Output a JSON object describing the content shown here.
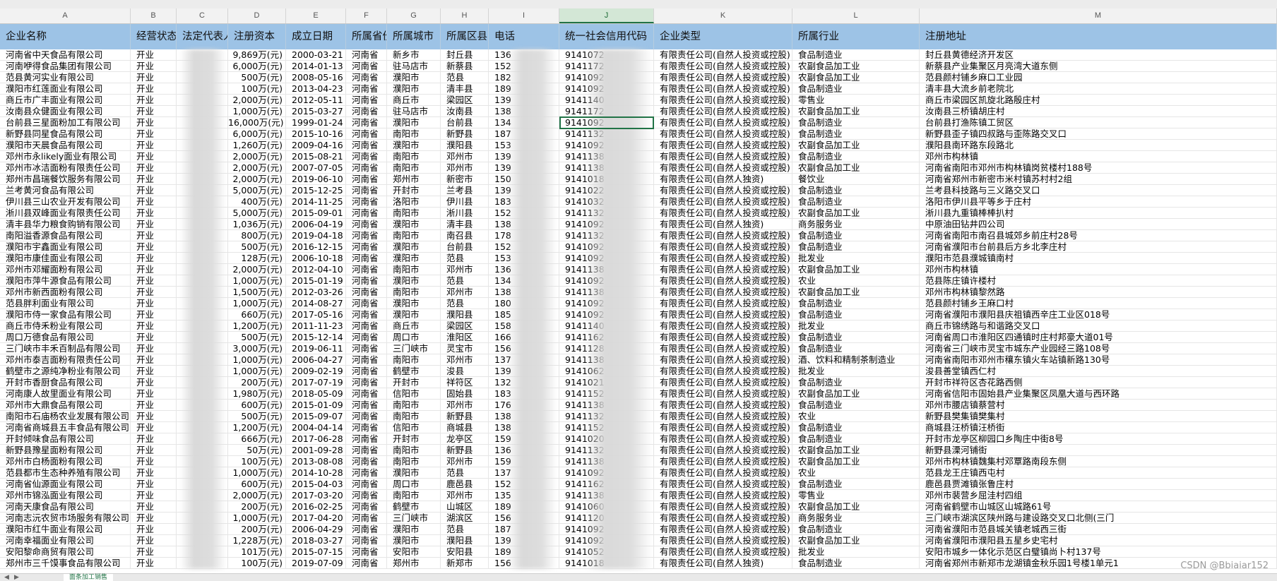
{
  "column_letters": [
    "A",
    "B",
    "C",
    "D",
    "E",
    "F",
    "G",
    "H",
    "I",
    "J",
    "K",
    "L",
    "M"
  ],
  "selected_column": "J",
  "headers": [
    "企业名称",
    "经营状态",
    "法定代表人",
    "注册资本",
    "成立日期",
    "所属省份",
    "所属城市",
    "所属区县",
    "电话",
    "统一社会信用代码",
    "企业类型",
    "所属行业",
    "注册地址"
  ],
  "rows": [
    [
      "河南省中天食品有限公司",
      "开业",
      "",
      "9,869万(元)",
      "2000-03-21",
      "河南省",
      "新乡市",
      "封丘县",
      "136",
      "9141072",
      "有限责任公司(自然人投资或控股)",
      "食品制造业",
      "封丘县黄德经济开发区"
    ],
    [
      "河南咿得食品集团有限公司",
      "开业",
      "",
      "6,000万(元)",
      "2014-01-13",
      "河南省",
      "驻马店市",
      "新蔡县",
      "152",
      "9141172",
      "有限责任公司(自然人投资或控股)",
      "农副食品加工业",
      "新蔡县产业集聚区月亮湾大道东侧"
    ],
    [
      "范县黄河实业有限公司",
      "开业",
      "",
      "500万(元)",
      "2008-05-16",
      "河南省",
      "濮阳市",
      "范县",
      "182",
      "9141092",
      "有限责任公司(自然人投资或控股)",
      "农副食品加工业",
      "范县颜村铺乡麻口工业园"
    ],
    [
      "濮阳市红莲面业有限公司",
      "开业",
      "",
      "100万(元)",
      "2013-04-23",
      "河南省",
      "濮阳市",
      "清丰县",
      "189",
      "9141092",
      "有限责任公司(自然人投资或控股)",
      "食品制造业",
      "清丰县大流乡前老院北"
    ],
    [
      "商丘市广丰面业有限公司",
      "开业",
      "",
      "2,000万(元)",
      "2012-05-11",
      "河南省",
      "商丘市",
      "梁园区",
      "139",
      "9141140",
      "有限责任公司(自然人投资或控股)",
      "零售业",
      "商丘市梁园区凯旋北路殷庄村"
    ],
    [
      "汝南县众健面业有限公司",
      "开业",
      "",
      "1,000万(元)",
      "2015-03-27",
      "河南省",
      "驻马店市",
      "汝南县",
      "138",
      "9141172",
      "有限责任公司(自然人投资或控股)",
      "农副食品加工业",
      "汝南县三桥镇胡庄村"
    ],
    [
      "台前县三星面粉加工有限公司",
      "开业",
      "",
      "16,000万(元)",
      "1999-01-24",
      "河南省",
      "濮阳市",
      "台前县",
      "134",
      "9141092",
      "有限责任公司(自然人投资或控股)",
      "食品制造业",
      "台前县打渔陈镇工贸区"
    ],
    [
      "新野县同星食品有限公司",
      "开业",
      "",
      "6,000万(元)",
      "2015-10-16",
      "河南省",
      "南阳市",
      "新野县",
      "187",
      "9141132",
      "有限责任公司(自然人投资或控股)",
      "食品制造业",
      "新野县歪子镇四叔路与歪陈路交叉口"
    ],
    [
      "濮阳市天晨食品有限公司",
      "开业",
      "",
      "1,260万(元)",
      "2009-04-16",
      "河南省",
      "濮阳市",
      "濮阳县",
      "153",
      "9141092",
      "有限责任公司(自然人投资或控股)",
      "农副食品加工业",
      "濮阳县南环路东段路北"
    ],
    [
      "邓州市永likely面业有限公司",
      "开业",
      "",
      "2,000万(元)",
      "2015-08-21",
      "河南省",
      "南阳市",
      "邓州市",
      "139",
      "9141138",
      "有限责任公司(自然人投资或控股)",
      "食品制造业",
      "邓州市构林镇"
    ],
    [
      "邓州市冰洁面粉有限责任公司",
      "开业",
      "",
      "2,000万(元)",
      "2007-07-05",
      "河南省",
      "南阳市",
      "邓州市",
      "139",
      "9141138",
      "有限责任公司(自然人投资或控股)",
      "农副食品加工业",
      "河南省南阳市邓州市构林镇岗贫楼村188号"
    ],
    [
      "郑州市昌瑞餐饮服务有限公司",
      "开业",
      "",
      "2,000万(元)",
      "2019-06-10",
      "河南省",
      "郑州市",
      "新密市",
      "150",
      "9141018",
      "有限责任公司(自然人独资)",
      "餐饮业",
      "河南省郑州市新密市米村镇苏村村2组"
    ],
    [
      "兰考黄河食品有限公司",
      "开业",
      "",
      "5,000万(元)",
      "2015-12-25",
      "河南省",
      "开封市",
      "兰考县",
      "139",
      "9141022",
      "有限责任公司(自然人投资或控股)",
      "食品制造业",
      "兰考县科技路与三义路交叉口"
    ],
    [
      "伊川县三山农业开发有限公司",
      "开业",
      "",
      "400万(元)",
      "2014-11-25",
      "河南省",
      "洛阳市",
      "伊川县",
      "183",
      "9141032",
      "有限责任公司(自然人投资或控股)",
      "食品制造业",
      "洛阳市伊川县平等乡于庄村"
    ],
    [
      "淅川县双峰面业有限责任公司",
      "开业",
      "",
      "5,000万(元)",
      "2015-09-01",
      "河南省",
      "南阳市",
      "淅川县",
      "152",
      "9141132",
      "有限责任公司(自然人投资或控股)",
      "农副食品加工业",
      "淅川县九重镇棒棒扒村"
    ],
    [
      "清丰县华力粮食购销有限公司",
      "开业",
      "",
      "1,036万(元)",
      "2006-04-19",
      "河南省",
      "濮阳市",
      "清丰县",
      "138",
      "9141092",
      "有限责任公司(自然人独资)",
      "商务服务业",
      "中原油田钻井四公司"
    ],
    [
      "南阳溢香源食品有限公司",
      "开业",
      "",
      "800万(元)",
      "2019-04-18",
      "河南省",
      "南阳市",
      "南召县",
      "178",
      "9141132",
      "有限责任公司(自然人投资或控股)",
      "食品制造业",
      "河南省南阳市南召县城郊乡前庄村28号"
    ],
    [
      "濮阳市宇鑫面业有限公司",
      "开业",
      "",
      "500万(元)",
      "2016-12-15",
      "河南省",
      "濮阳市",
      "台前县",
      "152",
      "9141092",
      "有限责任公司(自然人投资或控股)",
      "食品制造业",
      "河南省濮阳市台前县后方乡北李庄村"
    ],
    [
      "濮阳市康佳面业有限公司",
      "开业",
      "",
      "128万(元)",
      "2006-10-18",
      "河南省",
      "濮阳市",
      "范县",
      "153",
      "9141092",
      "有限责任公司(自然人投资或控股)",
      "批发业",
      "濮阳市范县濮城镇南村"
    ],
    [
      "邓州市邓耀面粉有限公司",
      "开业",
      "",
      "2,000万(元)",
      "2012-04-10",
      "河南省",
      "南阳市",
      "邓州市",
      "136",
      "9141138",
      "有限责任公司(自然人投资或控股)",
      "农副食品加工业",
      "邓州市构林镇"
    ],
    [
      "濮阳市萍牛源食品有限公司",
      "开业",
      "",
      "1,000万(元)",
      "2015-01-19",
      "河南省",
      "濮阳市",
      "范县",
      "134",
      "9141092",
      "有限责任公司(自然人投资或控股)",
      "农业",
      "范县陈庄镇许楼村"
    ],
    [
      "邓州市新西面粉有限公司",
      "开业",
      "",
      "1,500万(元)",
      "2012-03-26",
      "河南省",
      "南阳市",
      "邓州市",
      "138",
      "9141138",
      "有限责任公司(自然人投资或控股)",
      "农副食品加工业",
      "邓州市构林镇黎然路"
    ],
    [
      "范县胖利面业有限公司",
      "开业",
      "",
      "1,000万(元)",
      "2014-08-27",
      "河南省",
      "濮阳市",
      "范县",
      "180",
      "9141092",
      "有限责任公司(自然人投资或控股)",
      "食品制造业",
      "范县颜村铺乡王麻口村"
    ],
    [
      "濮阳市侍一家食品有限公司",
      "开业",
      "",
      "660万(元)",
      "2017-05-16",
      "河南省",
      "濮阳市",
      "濮阳县",
      "185",
      "9141092",
      "有限责任公司(自然人投资或控股)",
      "食品制造业",
      "河南省濮阳市濮阳县庆祖镇西辛庄工业区018号"
    ],
    [
      "商丘市侍禾粉业有限公司",
      "开业",
      "",
      "1,200万(元)",
      "2011-11-23",
      "河南省",
      "商丘市",
      "梁园区",
      "158",
      "9141140",
      "有限责任公司(自然人投资或控股)",
      "批发业",
      "商丘市锦绣路与和谐路交叉口"
    ],
    [
      "周口万德食品有限公司",
      "开业",
      "",
      "500万(元)",
      "2015-12-14",
      "河南省",
      "周口市",
      "淮阳区",
      "166",
      "9141162",
      "有限责任公司(自然人投资或控股)",
      "食品制造业",
      "河南省周口市淮阳区四通镇时庄村邦豪大道01号"
    ],
    [
      "三门峡市丰禾百制品有限公司",
      "开业",
      "",
      "3,000万(元)",
      "2019-06-11",
      "河南省",
      "三门峡市",
      "灵宝市",
      "156",
      "9141128",
      "有限责任公司(自然人投资或控股)",
      "食品制造业",
      "河南省三门峡市灵宝市城东产业园经三路108号"
    ],
    [
      "邓州市泰吉面粉有限责任公司",
      "开业",
      "",
      "1,000万(元)",
      "2006-04-27",
      "河南省",
      "南阳市",
      "邓州市",
      "137",
      "9141138",
      "有限责任公司(自然人投资或控股)",
      "酒、饮料和精制茶制造业",
      "河南省南阳市邓州市穰东镇火车站镇新路130号"
    ],
    [
      "鹤壁市之源纯净粉业有限公司",
      "开业",
      "",
      "1,000万(元)",
      "2009-02-19",
      "河南省",
      "鹤壁市",
      "浚县",
      "139",
      "9141062",
      "有限责任公司(自然人投资或控股)",
      "批发业",
      "浚县善堂镇西仁村"
    ],
    [
      "开封市香厨食品有限公司",
      "开业",
      "",
      "200万(元)",
      "2017-07-19",
      "河南省",
      "开封市",
      "祥符区",
      "132",
      "9141021",
      "有限责任公司(自然人投资或控股)",
      "食品制造业",
      "开封市祥符区杏花路西侧"
    ],
    [
      "河南康人故里面业有限公司",
      "开业",
      "",
      "1,980万(元)",
      "2018-05-09",
      "河南省",
      "信阳市",
      "固始县",
      "183",
      "9141152",
      "有限责任公司(自然人投资或控股)",
      "农副食品加工业",
      "河南省信阳市固始县产业集聚区凤凰大道与西环路"
    ],
    [
      "邓州市大鼎食品有限公司",
      "开业",
      "",
      "600万(元)",
      "2015-01-09",
      "河南省",
      "南阳市",
      "邓州市",
      "176",
      "9141138",
      "有限责任公司(自然人投资或控股)",
      "食品制造业",
      "邓州市腰店镇蔡营村"
    ],
    [
      "南阳市石庙杨农业发展有限公司",
      "开业",
      "",
      "500万(元)",
      "2015-09-07",
      "河南省",
      "南阳市",
      "新野县",
      "138",
      "9141132",
      "有限责任公司(自然人投资或控股)",
      "农业",
      "新野县樊集镇樊集村"
    ],
    [
      "河南省商城县五丰食品有限公司",
      "开业",
      "",
      "1,200万(元)",
      "2004-04-14",
      "河南省",
      "信阳市",
      "商城县",
      "138",
      "9141152",
      "有限责任公司(自然人投资或控股)",
      "食品制造业",
      "商城县汪桥镇汪桥街"
    ],
    [
      "开封倾味食品有限公司",
      "开业",
      "",
      "666万(元)",
      "2017-06-28",
      "河南省",
      "开封市",
      "龙亭区",
      "159",
      "9141020",
      "有限责任公司(自然人投资或控股)",
      "食品制造业",
      "开封市龙亭区柳园口乡陶庄中街8号"
    ],
    [
      "新野县豫星面粉有限公司",
      "开业",
      "",
      "50万(元)",
      "2001-09-28",
      "河南省",
      "南阳市",
      "新野县",
      "136",
      "9141132",
      "有限责任公司(自然人投资或控股)",
      "农副食品加工业",
      "新野县溧河铺街"
    ],
    [
      "邓州市白杨面粉有限公司",
      "开业",
      "",
      "100万(元)",
      "2013-08-08",
      "河南省",
      "南阳市",
      "邓州市",
      "159",
      "9141138",
      "有限责任公司(自然人投资或控股)",
      "农副食品加工业",
      "邓州市构林镇魏集村邓覃路南段东侧"
    ],
    [
      "范县都市生态种养殖有限公司",
      "开业",
      "",
      "1,000万(元)",
      "2014-10-28",
      "河南省",
      "濮阳市",
      "范县",
      "137",
      "9141092",
      "有限责任公司(自然人投资或控股)",
      "农业",
      "范县龙王庄镇西屯村"
    ],
    [
      "河南省仙源面业有限公司",
      "开业",
      "",
      "600万(元)",
      "2015-04-03",
      "河南省",
      "周口市",
      "鹿邑县",
      "152",
      "9141162",
      "有限责任公司(自然人投资或控股)",
      "食品制造业",
      "鹿邑县贾滩镇张鲁庄村"
    ],
    [
      "邓州市锦泓面业有限公司",
      "开业",
      "",
      "2,000万(元)",
      "2017-03-20",
      "河南省",
      "南阳市",
      "邓州市",
      "135",
      "9141138",
      "有限责任公司(自然人投资或控股)",
      "零售业",
      "邓州市裴营乡屈洼村四组"
    ],
    [
      "河南天康食品有限公司",
      "开业",
      "",
      "200万(元)",
      "2016-02-25",
      "河南省",
      "鹤壁市",
      "山城区",
      "189",
      "9141060",
      "有限责任公司(自然人投资或控股)",
      "农副食品加工业",
      "河南省鹤壁市山城区山城路61号"
    ],
    [
      "河南志沅农贸市场服务有限公司",
      "开业",
      "",
      "1,000万(元)",
      "2017-04-20",
      "河南省",
      "三门峡市",
      "湖滨区",
      "156",
      "9141120",
      "有限责任公司(自然人投资或控股)",
      "商务服务业",
      "三门峡市湖滨区陕州路与建设路交叉口北侧(三门"
    ],
    [
      "濮阳市红牛面业有限公司",
      "开业",
      "",
      "200万(元)",
      "2006-04-29",
      "河南省",
      "濮阳市",
      "范县",
      "187",
      "9141092",
      "有限责任公司(自然人投资或控股)",
      "食品制造业",
      "河南省濮阳市范县城关镇老城西三街"
    ],
    [
      "河南幸福面业有限公司",
      "开业",
      "",
      "1,228万(元)",
      "2018-03-27",
      "河南省",
      "濮阳市",
      "濮阳县",
      "139",
      "9141092",
      "有限责任公司(自然人投资或控股)",
      "农副食品加工业",
      "河南省濮阳市濮阳县五星乡史宅村"
    ],
    [
      "安阳黎命商贸有限公司",
      "开业",
      "",
      "101万(元)",
      "2015-07-15",
      "河南省",
      "安阳市",
      "安阳县",
      "189",
      "9141052",
      "有限责任公司(自然人投资或控股)",
      "批发业",
      "安阳市城乡一体化示范区白璧镇尚卜村137号"
    ],
    [
      "郑州市三千馍事食品有限公司",
      "开业",
      "",
      "100万(元)",
      "2019-07-09",
      "河南省",
      "郑州市",
      "新郑市",
      "156",
      "9141018",
      "有限责任公司(自然人独资)",
      "食品制造业",
      "河南省郑州市新郑市龙湖镇金秋乐园1号楼1单元1"
    ]
  ],
  "sheet_tab": "面条加工销售",
  "watermark": "CSDN @Bbiaiar152"
}
